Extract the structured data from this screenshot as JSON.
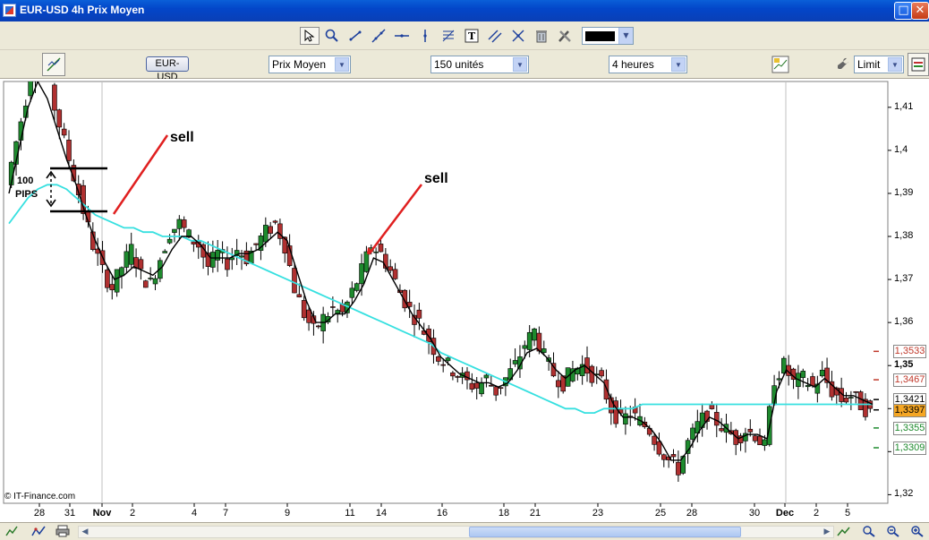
{
  "window": {
    "title": "EUR-USD 4h Prix Moyen",
    "maximize_glyph": "□",
    "close_glyph": "✕"
  },
  "toolbar_top": {
    "tools": [
      "pointer-icon",
      "zoom-icon",
      "line-icon",
      "trendline-icon",
      "hline-icon",
      "vline-icon",
      "fibonacci-icon",
      "text-icon",
      "channel-icon",
      "crosshair-icon",
      "trash-icon",
      "tools-icon"
    ],
    "color": "#000000"
  },
  "toolbar_second": {
    "pair": "EUR-USD",
    "price_type": "Prix Moyen",
    "units": "150 unités",
    "timeframe": "4 heures",
    "order_type": "Limit"
  },
  "chart_data": {
    "type": "candlestick",
    "instrument": "EUR-USD",
    "timeframe": "4h",
    "ylim": [
      1.318,
      1.416
    ],
    "y_ticks": [
      "1,41",
      "1,4",
      "1,39",
      "1,38",
      "1,37",
      "1,36",
      "1,35",
      "1,34",
      "1,33",
      "1,32"
    ],
    "y_tick_values": [
      1.41,
      1.4,
      1.39,
      1.38,
      1.37,
      1.36,
      1.35,
      1.34,
      1.33,
      1.32
    ],
    "x_ticks": [
      {
        "label": "28",
        "bold": false
      },
      {
        "label": "31",
        "bold": false
      },
      {
        "label": "Nov",
        "bold": true
      },
      {
        "label": "2",
        "bold": false
      },
      {
        "label": "4",
        "bold": false
      },
      {
        "label": "7",
        "bold": false
      },
      {
        "label": "9",
        "bold": false
      },
      {
        "label": "11",
        "bold": false
      },
      {
        "label": "14",
        "bold": false
      },
      {
        "label": "16",
        "bold": false
      },
      {
        "label": "18",
        "bold": false
      },
      {
        "label": "21",
        "bold": false
      },
      {
        "label": "23",
        "bold": false
      },
      {
        "label": "25",
        "bold": false
      },
      {
        "label": "28",
        "bold": false
      },
      {
        "label": "30",
        "bold": false
      },
      {
        "label": "Dec",
        "bold": true
      },
      {
        "label": "2",
        "bold": false
      },
      {
        "label": "5",
        "bold": false
      }
    ],
    "close_path": [
      1.392,
      1.402,
      1.412,
      1.423,
      1.42,
      1.41,
      1.402,
      1.394,
      1.386,
      1.378,
      1.372,
      1.368,
      1.373,
      1.377,
      1.371,
      1.369,
      1.375,
      1.381,
      1.383,
      1.38,
      1.378,
      1.373,
      1.376,
      1.374,
      1.377,
      1.375,
      1.378,
      1.381,
      1.383,
      1.378,
      1.368,
      1.362,
      1.358,
      1.361,
      1.363,
      1.362,
      1.367,
      1.372,
      1.378,
      1.376,
      1.372,
      1.367,
      1.363,
      1.36,
      1.356,
      1.352,
      1.35,
      1.348,
      1.346,
      1.345,
      1.347,
      1.344,
      1.347,
      1.35,
      1.355,
      1.358,
      1.352,
      1.348,
      1.346,
      1.349,
      1.35,
      1.348,
      1.346,
      1.34,
      1.337,
      1.339,
      1.337,
      1.335,
      1.331,
      1.328,
      1.326,
      1.332,
      1.336,
      1.339,
      1.337,
      1.335,
      1.333,
      1.335,
      1.334,
      1.331,
      1.347,
      1.35,
      1.346,
      1.347,
      1.345,
      1.348,
      1.344,
      1.342,
      1.343,
      1.341,
      1.339
    ],
    "ma_short_path": [
      1.39,
      1.4,
      1.41,
      1.416,
      1.412,
      1.405,
      1.398,
      1.392,
      1.385,
      1.379,
      1.374,
      1.37,
      1.371,
      1.373,
      1.372,
      1.371,
      1.373,
      1.377,
      1.38,
      1.38,
      1.378,
      1.375,
      1.375,
      1.375,
      1.376,
      1.376,
      1.377,
      1.379,
      1.381,
      1.379,
      1.372,
      1.365,
      1.36,
      1.36,
      1.362,
      1.362,
      1.365,
      1.369,
      1.375,
      1.374,
      1.37,
      1.366,
      1.362,
      1.359,
      1.356,
      1.352,
      1.35,
      1.348,
      1.347,
      1.346,
      1.346,
      1.345,
      1.346,
      1.349,
      1.353,
      1.354,
      1.352,
      1.349,
      1.347,
      1.349,
      1.35,
      1.348,
      1.346,
      1.341,
      1.338,
      1.338,
      1.337,
      1.335,
      1.332,
      1.328,
      1.328,
      1.331,
      1.335,
      1.338,
      1.337,
      1.335,
      1.333,
      1.334,
      1.334,
      1.333,
      1.344,
      1.349,
      1.347,
      1.346,
      1.345,
      1.347,
      1.345,
      1.343,
      1.343,
      1.342,
      1.341
    ],
    "ma_long_path": [
      1.383,
      1.386,
      1.389,
      1.391,
      1.392,
      1.392,
      1.391,
      1.389,
      1.387,
      1.385,
      1.384,
      1.383,
      1.382,
      1.382,
      1.381,
      1.381,
      1.38,
      1.38,
      1.38,
      1.379,
      1.379,
      1.378,
      1.377,
      1.376,
      1.375,
      1.374,
      1.373,
      1.372,
      1.371,
      1.37,
      1.369,
      1.368,
      1.367,
      1.366,
      1.365,
      1.364,
      1.363,
      1.362,
      1.361,
      1.36,
      1.359,
      1.358,
      1.357,
      1.356,
      1.355,
      1.353,
      1.352,
      1.351,
      1.35,
      1.349,
      1.348,
      1.347,
      1.346,
      1.345,
      1.344,
      1.343,
      1.342,
      1.341,
      1.34,
      1.34,
      1.339,
      1.339,
      1.34,
      1.34,
      1.34,
      1.34,
      1.341,
      1.341,
      1.341,
      1.341,
      1.341,
      1.341,
      1.341,
      1.341,
      1.341,
      1.341,
      1.341,
      1.341,
      1.341,
      1.341,
      1.341,
      1.341,
      1.341,
      1.341,
      1.341,
      1.341,
      1.341,
      1.341,
      1.341,
      1.341,
      1.341
    ],
    "price_boxes": [
      {
        "label": "1,3533",
        "value": 1.3533,
        "color": "#c0392b",
        "highlight": false
      },
      {
        "label": "1,3467",
        "value": 1.3467,
        "color": "#c0392b",
        "highlight": false
      },
      {
        "label": "1,3421",
        "value": 1.3421,
        "color": "#000000",
        "highlight": false
      },
      {
        "label": "1,3397",
        "value": 1.3397,
        "color": "#000000",
        "highlight": true
      },
      {
        "label": "1,3355",
        "value": 1.3355,
        "color": "#1e8a2e",
        "highlight": false
      },
      {
        "label": "1,3309",
        "value": 1.3309,
        "color": "#1e8a2e",
        "highlight": false
      }
    ],
    "annotations": {
      "sell_1": "sell",
      "sell_2": "sell",
      "pips_number": "100",
      "pips_word": "PIPS"
    },
    "colors": {
      "up": "#1e8a2e",
      "down": "#b03030",
      "ma_short": "#000000",
      "ma_long": "#37e0e0",
      "annotation_arrow": "#e02020"
    },
    "grid": false,
    "copyright": "© IT-Finance.com"
  }
}
